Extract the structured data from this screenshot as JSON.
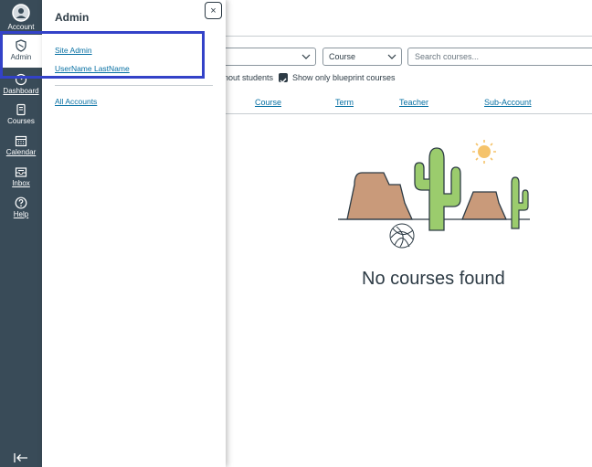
{
  "global_nav": {
    "account": "Account",
    "admin": "Admin",
    "dashboard": "Dashboard",
    "courses": "Courses",
    "calendar": "Calendar",
    "inbox": "Inbox",
    "help": "Help"
  },
  "filters": {
    "term_select_value": "",
    "course_select_value": "Course",
    "search_placeholder": "Search courses...",
    "hide_without_students_label": "nout students",
    "blueprint_label": "Show only blueprint courses"
  },
  "table": {
    "headers": [
      "Course",
      "Term",
      "Teacher",
      "Sub-Account"
    ]
  },
  "empty_state": {
    "message": "No courses found"
  },
  "admin_tray": {
    "title": "Admin",
    "close_glyph": "×",
    "links": [
      "Site Admin",
      "UserName LastName",
      "All Accounts"
    ]
  },
  "colors": {
    "nav_bg": "#394b58",
    "link": "#0770a3",
    "highlight": "#3342c8",
    "text": "#2d3b45"
  }
}
